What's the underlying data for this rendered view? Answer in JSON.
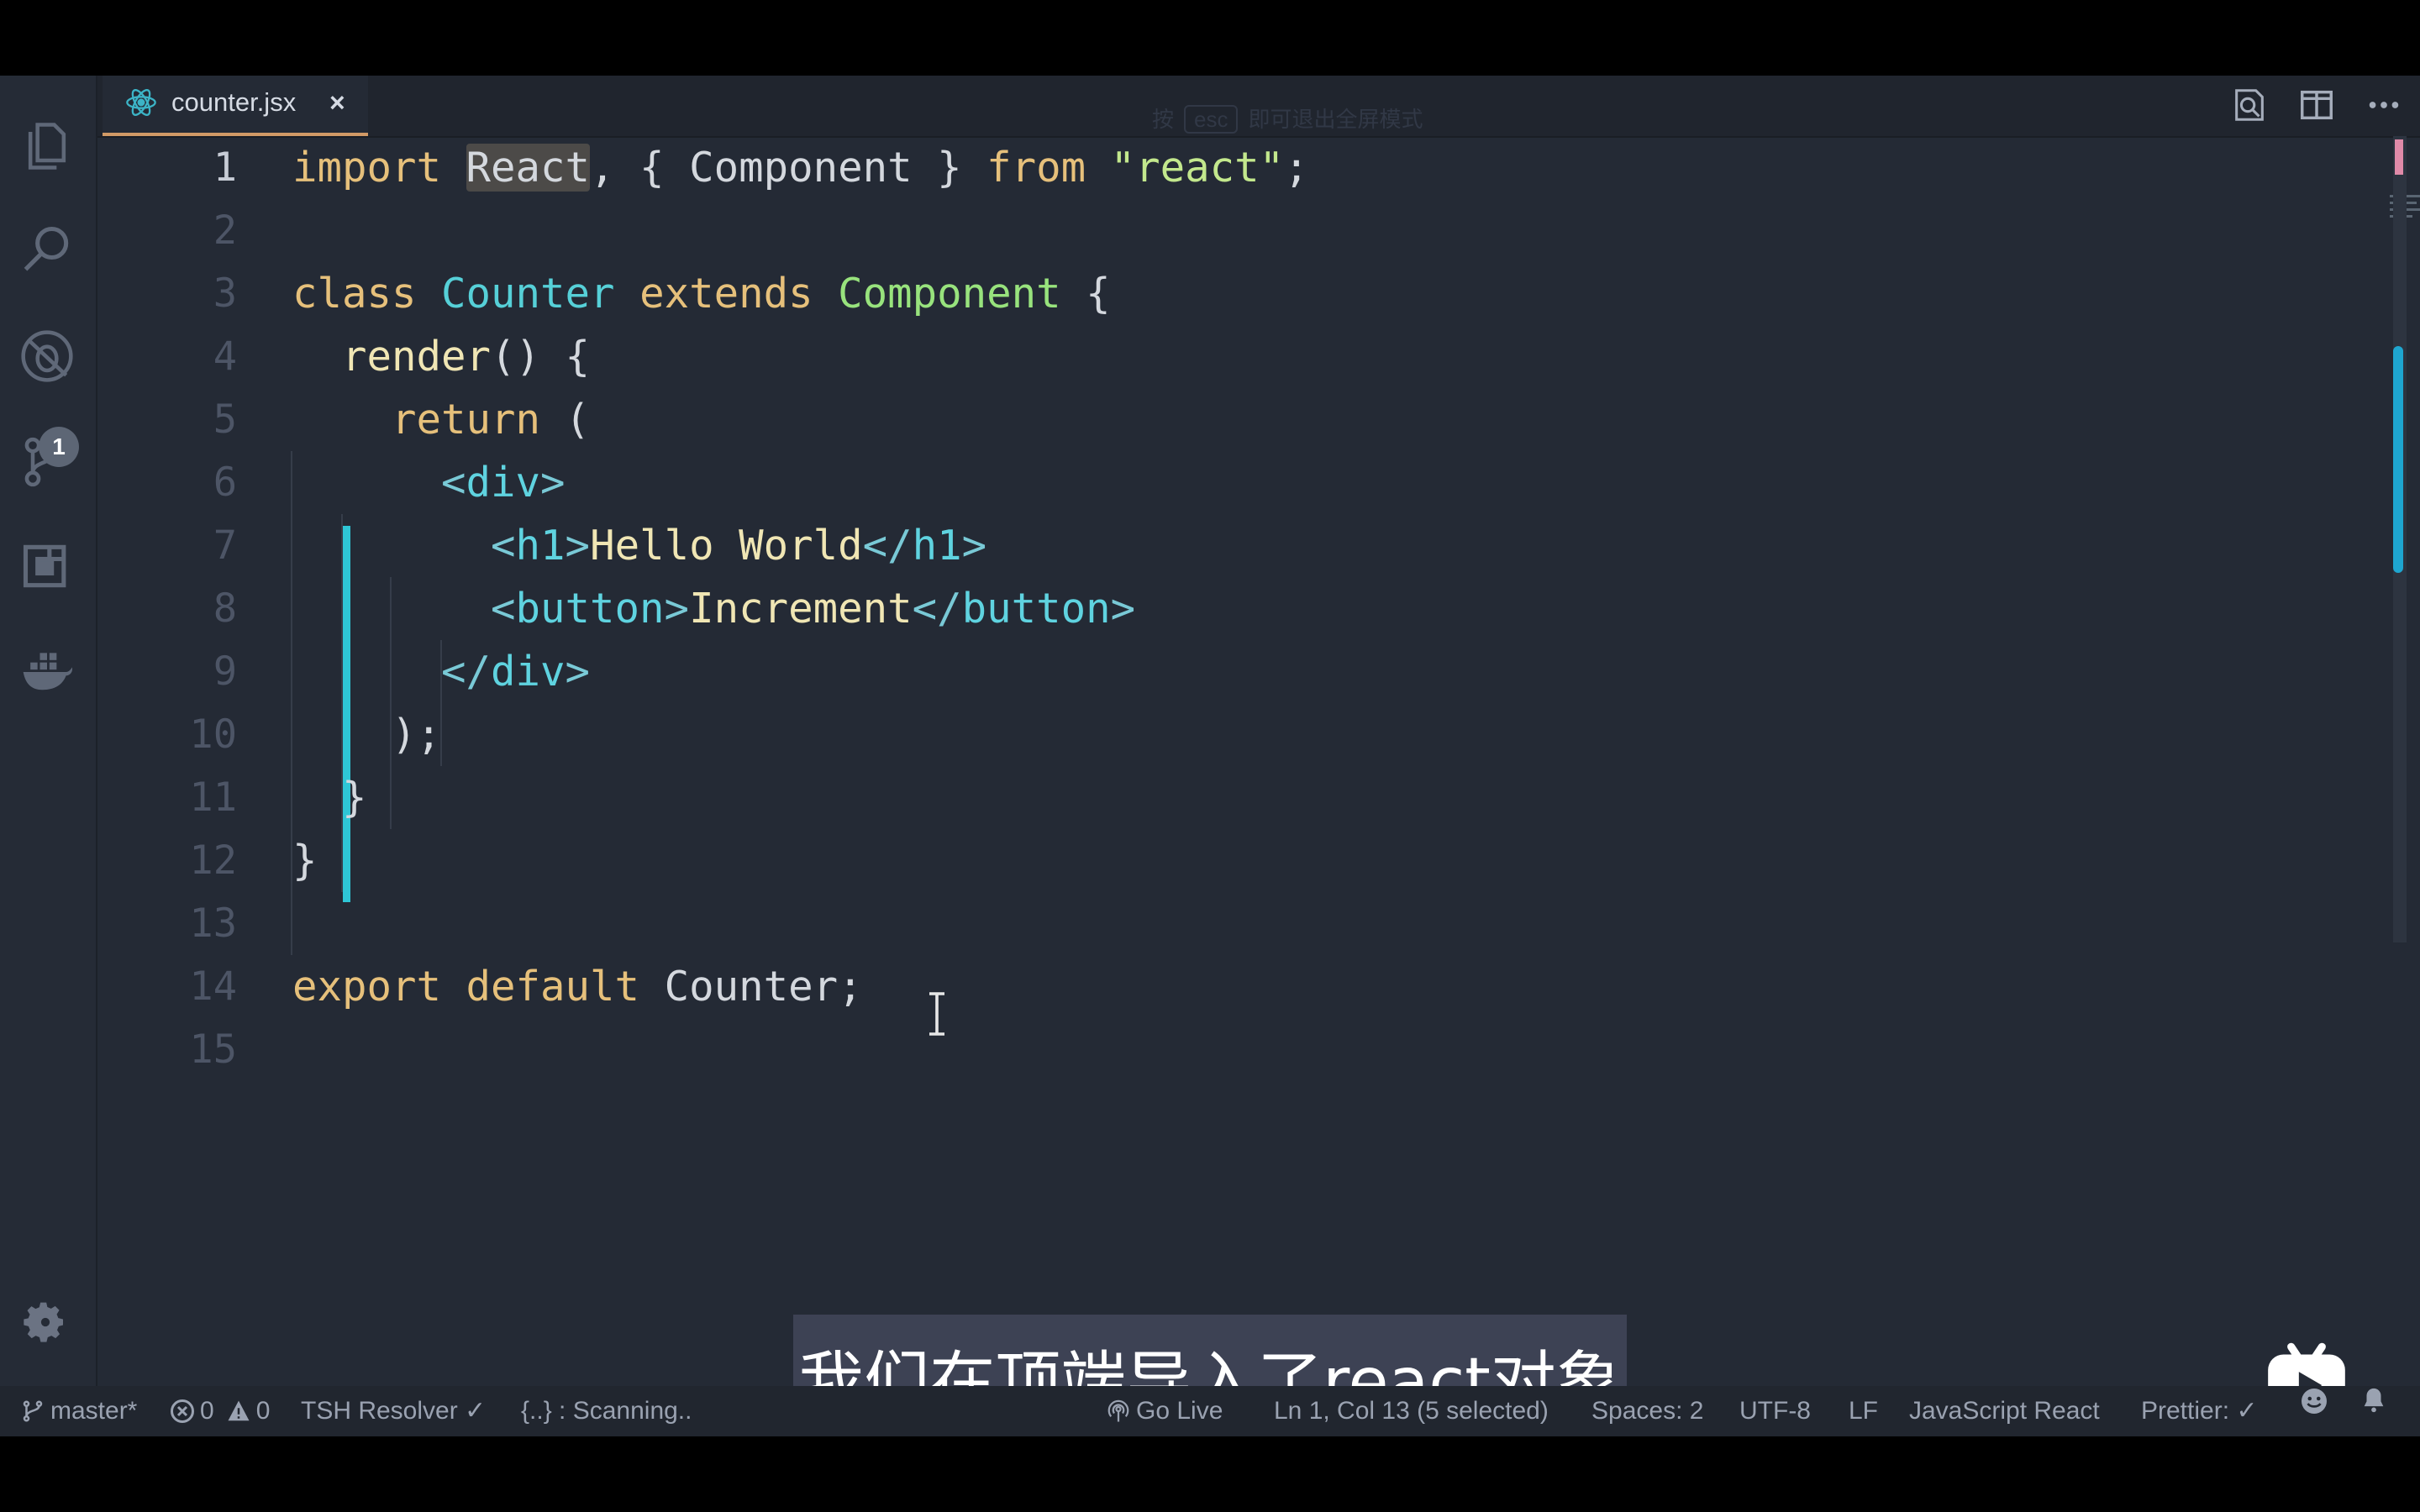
{
  "tab": {
    "filename": "counter.jsx",
    "close_glyph": "×"
  },
  "hint": {
    "before": "按",
    "key": "esc",
    "after": "即可退出全屏模式"
  },
  "activity": {
    "scm_badge": "1"
  },
  "editor": {
    "line_numbers": [
      "1",
      "2",
      "3",
      "4",
      "5",
      "6",
      "7",
      "8",
      "9",
      "10",
      "11",
      "12",
      "13",
      "14",
      "15"
    ],
    "active_line": "1"
  },
  "code": {
    "l1": {
      "import": "import",
      "react": "React",
      "sep1": ", { ",
      "component": "Component",
      "sep2": " } ",
      "from": "from",
      "str": "\"react\"",
      "end": ";"
    },
    "l3": {
      "class": "class",
      "name": "Counter",
      "extends": "extends",
      "base": "Component",
      "brace": " {"
    },
    "l4": {
      "method": "render",
      "rest": "() {"
    },
    "l5": {
      "kw": "return",
      "rest": " ("
    },
    "l6": {
      "open": "<",
      "tag": "div",
      "close": ">"
    },
    "l7": {
      "open": "<",
      "tag": "h1",
      "close": ">",
      "text": "Hello World",
      "open2": "</",
      "tag2": "h1",
      "close2": ">"
    },
    "l8": {
      "open": "<",
      "tag": "button",
      "close": ">",
      "text": "Increment",
      "open2": "</",
      "tag2": "button",
      "close2": ">"
    },
    "l9": {
      "open": "</",
      "tag": "div",
      "close": ">"
    },
    "l10": {
      "text": ");"
    },
    "l11": {
      "text": "}"
    },
    "l12": {
      "text": "}"
    },
    "l14": {
      "export": "export",
      "default": "default",
      "name": "Counter",
      "end": ";"
    }
  },
  "subtitle": "我们在顶端导入了react对象",
  "status": {
    "branch": "master*",
    "errors": "0",
    "warnings": "0",
    "resolver": "TSH Resolver ✓",
    "scanning": "{..} : Scanning..",
    "golive": "Go Live",
    "position": "Ln 1, Col 13 (5 selected)",
    "spaces": "Spaces: 2",
    "encoding": "UTF-8",
    "eol": "LF",
    "language": "JavaScript React",
    "prettier": "Prettier: ✓"
  }
}
